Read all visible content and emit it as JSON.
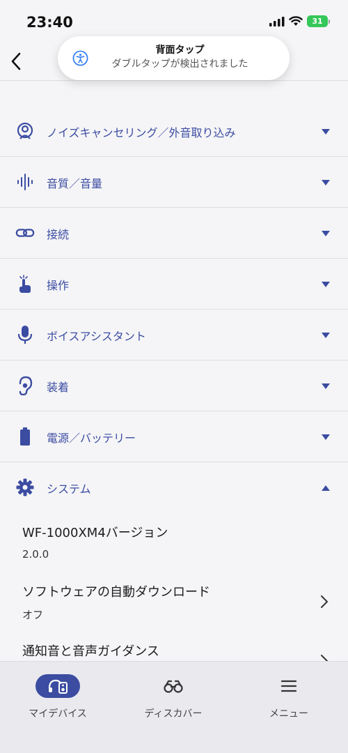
{
  "status_bar": {
    "time": "23:40",
    "battery": "31"
  },
  "toast": {
    "icon": "accessibility-icon",
    "title": "背面タップ",
    "subtitle": "ダブルタップが検出されました"
  },
  "sections": [
    {
      "label": "ノイズキャンセリング／外音取り込み",
      "icon": "headset-person-icon"
    },
    {
      "label": "音質／音量",
      "icon": "waveform-icon"
    },
    {
      "label": "接続",
      "icon": "link-icon"
    },
    {
      "label": "操作",
      "icon": "tap-gesture-icon"
    },
    {
      "label": "ボイスアシスタント",
      "icon": "microphone-icon"
    },
    {
      "label": "装着",
      "icon": "ear-icon"
    },
    {
      "label": "電源／バッテリー",
      "icon": "battery-icon"
    },
    {
      "label": "システム",
      "icon": "gear-icon"
    }
  ],
  "system_items": [
    {
      "title": "WF-1000XM4バージョン",
      "value": "2.0.0"
    },
    {
      "title": "ソフトウェアの自動ダウンロード",
      "value": "オフ"
    },
    {
      "title": "通知音と音声ガイダンス",
      "value": ""
    }
  ],
  "bottom_nav": [
    {
      "label": "マイデバイス",
      "icon": "headphones-device-icon",
      "active": true
    },
    {
      "label": "ディスカバー",
      "icon": "binoculars-icon",
      "active": false
    },
    {
      "label": "メニュー",
      "icon": "menu-icon",
      "active": false
    }
  ],
  "colors": {
    "accent": "#3b4ca1",
    "background": "#f5f5f7",
    "battery": "#35c759"
  }
}
